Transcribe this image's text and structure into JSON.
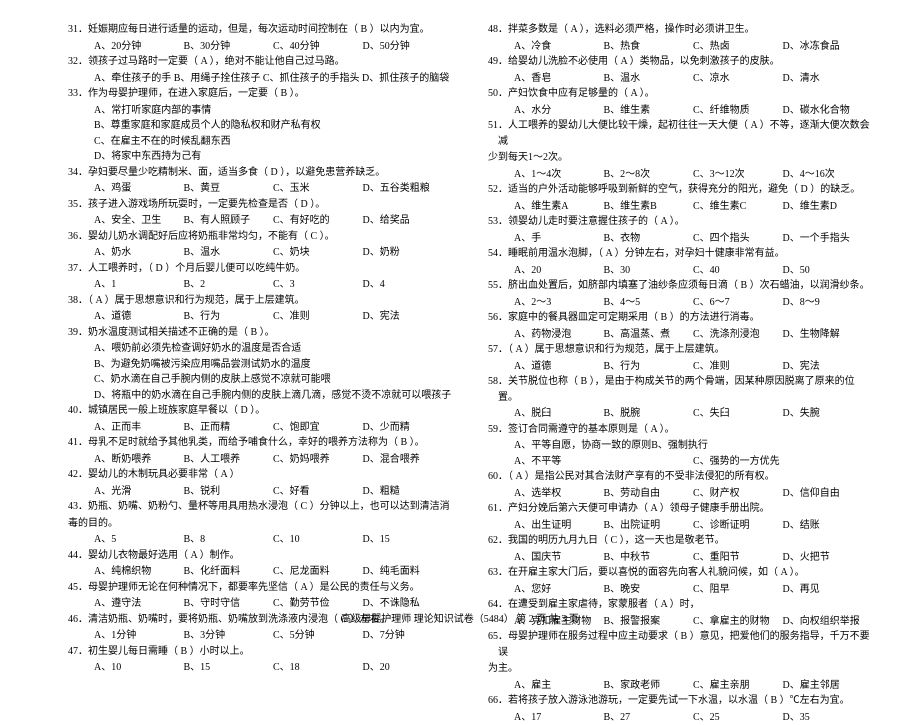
{
  "footer": "高级母婴护理师  理论知识试卷（5484）    第 2 页 共 3 页",
  "left": [
    {
      "type": "q",
      "t": "31．妊娠期应每日进行适量的运动，但是，每次运动时间控制在（ B ）以内为宜。"
    },
    {
      "type": "opts",
      "o": [
        "A、20分钟",
        "B、30分钟",
        "C、40分钟",
        "D、50分钟"
      ]
    },
    {
      "type": "q",
      "t": "32．领孩子过马路时一定要（ A ），绝对不能让他自己过马路。"
    },
    {
      "type": "sub",
      "t": "A、牵住孩子的手   B、用绳子拴住孩子   C、抓住孩子的手指头   D、抓住孩子的脑袋"
    },
    {
      "type": "q",
      "t": "33．作为母婴护理师，在进入家庭后，一定要（ B ）。"
    },
    {
      "type": "sub",
      "t": "A、常打听家庭内部的事情"
    },
    {
      "type": "sub",
      "t": "B、尊重家庭和家庭成员个人的隐私权和财产私有权"
    },
    {
      "type": "sub",
      "t": "C、在雇主不在的时候乱翻东西"
    },
    {
      "type": "sub",
      "t": "D、将家中东西持为己有"
    },
    {
      "type": "q",
      "t": "34．孕妇要尽量少吃精制米、面，适当多食（ D ），以避免患营养缺乏。"
    },
    {
      "type": "opts",
      "o": [
        "A、鸡蛋",
        "B、黄豆",
        "C、玉米",
        "D、五谷类粗粮"
      ]
    },
    {
      "type": "q",
      "t": "35．孩子进入游戏场所玩耍时，一定要先检查是否（ D ）。"
    },
    {
      "type": "opts",
      "o": [
        "A、安全、卫生",
        "B、有人照顾子",
        "C、有好吃的",
        "D、给奖品"
      ]
    },
    {
      "type": "q",
      "t": "36．婴幼儿奶水调配好后应将奶瓶非常均匀，不能有（ C ）。"
    },
    {
      "type": "opts",
      "o": [
        "A、奶水",
        "B、温水",
        "C、奶块",
        "D、奶粉"
      ]
    },
    {
      "type": "q",
      "t": "37．人工喂养时，（ D ）个月后婴儿便可以吃纯牛奶。"
    },
    {
      "type": "opts",
      "o": [
        "A、1",
        "B、2",
        "C、3",
        "D、4"
      ]
    },
    {
      "type": "q",
      "t": "38．（ A ）属于思想意识和行为规范，属于上层建筑。"
    },
    {
      "type": "opts",
      "o": [
        "A、道德",
        "B、行为",
        "C、准则",
        "D、宪法"
      ]
    },
    {
      "type": "q",
      "t": "39．奶水温度测试相关描述不正确的是（ B  ）。"
    },
    {
      "type": "sub",
      "t": "A、喂奶前必须先检查调好奶水的温度是否合适"
    },
    {
      "type": "sub",
      "t": "B、为避免奶嘴被污染应用嘴品尝测试奶水的温度"
    },
    {
      "type": "sub",
      "t": "C、奶水滴在自己手腕内侧的皮肤上感觉不凉就可能喂"
    },
    {
      "type": "sub",
      "t": "D、将瓶中的奶水滴在自己手腕内侧的皮肤上滴几滴，感觉不烫不凉就可以喂孩子"
    },
    {
      "type": "q",
      "t": "40．城镇居民一般上班族家庭早餐以（ D ）。"
    },
    {
      "type": "opts",
      "o": [
        "A、正而丰",
        "B、正而精",
        "C、饱即宜",
        "D、少而精"
      ]
    },
    {
      "type": "q",
      "t": "41．母乳不足时就给予其他乳类，而给予哺食什么，幸好的喂养方法称为（ B ）。"
    },
    {
      "type": "opts",
      "o": [
        "A、断奶喂养",
        "B、人工喂养",
        "C、奶妈喂养",
        "D、混合喂养"
      ]
    },
    {
      "type": "q",
      "t": "42．婴幼儿的木制玩具必要非常（ A ）"
    },
    {
      "type": "opts",
      "o": [
        "A、光滑",
        "B、锐利",
        "C、好看",
        "D、粗糙"
      ]
    },
    {
      "type": "q",
      "t": "43．奶瓶、奶嘴、奶粉勺、量杯等用具用热水浸泡（ C ）分钟以上，也可以达到清洁消"
    },
    {
      "type": "q",
      "t": "毒的目的。"
    },
    {
      "type": "opts",
      "o": [
        "A、5",
        "B、8",
        "C、10",
        "D、15"
      ]
    },
    {
      "type": "q",
      "t": "44．婴幼儿衣物最好选用（ A ）制作。"
    },
    {
      "type": "opts",
      "o": [
        "A、纯棉织物",
        "B、化纤面料",
        "C、尼龙面料",
        "D、纯毛面料"
      ]
    },
    {
      "type": "q",
      "t": "45．母婴护理师无论在何种情况下，都要率先坚信（ A ）是公民的责任与义务。"
    },
    {
      "type": "opts",
      "o": [
        "A、遵守法",
        "B、守时守信",
        "C、勤劳节俭",
        "D、不诛隐私"
      ]
    },
    {
      "type": "q",
      "t": "46．清洁奶瓶、奶嘴时，要将奶瓶、奶嘴放到洗涤液内浸泡（ C  ）左右。"
    },
    {
      "type": "opts",
      "o": [
        "A、1分钟",
        "B、3分钟",
        "C、5分钟",
        "D、7分钟"
      ]
    },
    {
      "type": "q",
      "t": "47．初生婴儿每日需睡（ B ）小时以上。"
    },
    {
      "type": "opts",
      "o": [
        "A、10",
        "B、15",
        "C、18",
        "D、20"
      ]
    }
  ],
  "right": [
    {
      "type": "q",
      "t": "48．拌菜多数是（ A ），选料必须严格，操作时必须讲卫生。"
    },
    {
      "type": "opts",
      "o": [
        "A、冷食",
        "B、热食",
        "C、热卤",
        "D、冰冻食品"
      ]
    },
    {
      "type": "q",
      "t": "49．给婴幼儿洗脸不必使用（ A ）类物品，以免刺激孩子的皮肤。"
    },
    {
      "type": "opts",
      "o": [
        "A、香皂",
        "B、温水",
        "C、凉水",
        "D、清水"
      ]
    },
    {
      "type": "q",
      "t": "50．产妇饮食中应有足够量的（ A ）。"
    },
    {
      "type": "opts",
      "o": [
        "A、水分",
        "B、维生素",
        "C、纤维物质",
        "D、碳水化合物"
      ]
    },
    {
      "type": "q",
      "t": "51．人工喂养的婴幼儿大便比较干燥，起初往往一天大便（ A ）不等，逐渐大便次数会减"
    },
    {
      "type": "q",
      "t": "少到每天1～2次。"
    },
    {
      "type": "opts",
      "o": [
        "A、1～4次",
        "B、2～8次",
        "C、3～12次",
        "D、4～16次"
      ]
    },
    {
      "type": "q",
      "t": "52．适当的户外活动能够呼吸到新鲜的空气，获得充分的阳光，避免（ D ）的缺乏。"
    },
    {
      "type": "opts",
      "o": [
        "A、维生素A",
        "B、维生素B",
        "C、维生素C",
        "D、维生素D"
      ]
    },
    {
      "type": "q",
      "t": "53．领婴幼儿走时要注意握住孩子的（ A ）。"
    },
    {
      "type": "opts",
      "o": [
        "A、手",
        "B、衣物",
        "C、四个指头",
        "D、一个手指头"
      ]
    },
    {
      "type": "q",
      "t": "54．睡眠前用温水泡脚，（ A ）分钟左右，对孕妇十健康非常有益。"
    },
    {
      "type": "opts",
      "o": [
        "A、20",
        "B、30",
        "C、40",
        "D、50"
      ]
    },
    {
      "type": "q",
      "t": "55．脐出血处置后，如脐部内填塞了油纱条应须每日滴（ B  ）次石蜡油，以润滑纱条。"
    },
    {
      "type": "opts",
      "o": [
        "A、2～3",
        "B、4～5",
        "C、6～7",
        "D、8～9"
      ]
    },
    {
      "type": "q",
      "t": "56．家庭中的餐具器皿定可定期采用（ B ）的方法进行消毒。"
    },
    {
      "type": "opts",
      "o": [
        "A、药物浸泡",
        "B、高温蒸、煮",
        "C、洗涤剂浸泡",
        "D、生物降解"
      ]
    },
    {
      "type": "q",
      "t": "57．（ A  ）属于思想意识和行为规范，属于上层建筑。"
    },
    {
      "type": "opts",
      "o": [
        "A、道德",
        "B、行为",
        "C、准则",
        "D、宪法"
      ]
    },
    {
      "type": "q",
      "t": "58．关节脱位也称（ B ），是由于构成关节的两个骨端，因某种原因脱离了原来的位置。"
    },
    {
      "type": "opts",
      "o": [
        "A、脱臼",
        "B、脱腕",
        "C、失臼",
        "D、失腕"
      ]
    },
    {
      "type": "q",
      "t": "59．签订合同需遵守的基本原则是（ A ）。"
    },
    {
      "type": "opts",
      "o": [
        "A、平等自愿，协商一致的原则",
        "B、强制执行",
        "",
        " "
      ]
    },
    {
      "type": "opts",
      "o": [
        "A、不平等",
        "",
        "C、强势的一方优先",
        ""
      ]
    },
    {
      "type": "q",
      "t": "60．（ A  ）是指公民对其合法财产享有的不受非法侵犯的所有权。"
    },
    {
      "type": "opts",
      "o": [
        "A、选举权",
        "B、劳动自由",
        "C、财产权",
        "D、信仰自由"
      ]
    },
    {
      "type": "q",
      "t": "61．产妇分娩后第六天便可申请办（ A ）领母子健康手册出院。"
    },
    {
      "type": "opts",
      "o": [
        "A、出生证明",
        "B、出院证明",
        "C、诊断证明",
        "D、结账"
      ]
    },
    {
      "type": "q",
      "t": "62．我国的明历九月九日（ C ），这一天也是敬老节。"
    },
    {
      "type": "opts",
      "o": [
        "A、国庆节",
        "B、中秋节",
        "C、重阳节",
        "D、火把节"
      ]
    },
    {
      "type": "q",
      "t": "63．在开雇主家大门后，要以喜悦的面容先向客人礼貌问候，如（ A ）。"
    },
    {
      "type": "opts",
      "o": [
        "A、您好",
        "B、晚安",
        "C、阻早",
        "D、再见"
      ]
    },
    {
      "type": "q",
      "t": "64．在遭受到雇主家虐待，家蒙服者（ A ）时，"
    },
    {
      "type": "opts",
      "o": [
        "A、克扣雇主财物",
        "B、报警报案",
        "C、拿雇主的财物",
        "D、向权组织举报"
      ]
    },
    {
      "type": "q",
      "t": "65．母婴护理师在服务过程中应主动要求（ B ）意见，把爱他们的服务指导，千万不要误"
    },
    {
      "type": "q",
      "t": "为主。"
    },
    {
      "type": "opts",
      "o": [
        "A、雇主",
        "B、家政老师",
        "C、雇主亲朋",
        "D、雇主邻居"
      ]
    },
    {
      "type": "q",
      "t": "66．若将孩子放入游泳池游玩，一定要先试一下水温，以水温（ B ）℃左右为宜。"
    },
    {
      "type": "opts",
      "o": [
        "A、17",
        "B、27",
        "C、25",
        "D、35"
      ]
    }
  ]
}
